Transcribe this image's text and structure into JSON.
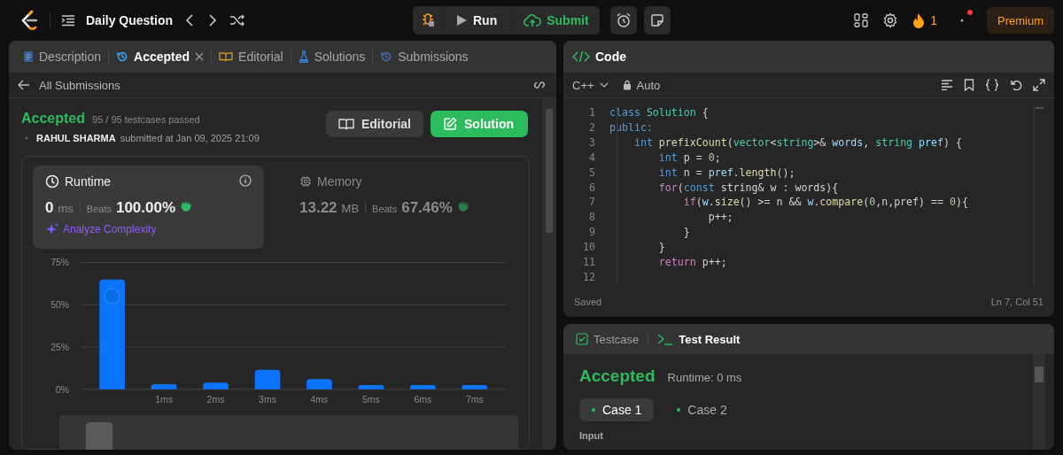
{
  "topbar": {
    "title": "Daily Question",
    "run": "Run",
    "submit": "Submit",
    "streak": "1",
    "premium": "Premium"
  },
  "left_tabs": [
    {
      "label": "Description",
      "kind": "doc",
      "selected": false,
      "closable": false
    },
    {
      "label": "Accepted",
      "kind": "clock",
      "selected": true,
      "closable": true
    },
    {
      "label": "Editorial",
      "kind": "book",
      "selected": false,
      "closable": false
    },
    {
      "label": "Solutions",
      "kind": "flask",
      "selected": false,
      "closable": false
    },
    {
      "label": "Submissions",
      "kind": "history",
      "selected": false,
      "closable": false
    }
  ],
  "back_link": "All Submissions",
  "result": {
    "status": "Accepted",
    "testcases": "95 / 95 testcases passed",
    "user": "RAHUL SHARMA",
    "submitted": "submitted at Jan 09, 2025 21:09",
    "buttons": [
      {
        "label": "Editorial",
        "kind": "secondary"
      },
      {
        "label": "Solution",
        "kind": "primary"
      }
    ]
  },
  "stats": [
    {
      "title": "Runtime",
      "kind": "time",
      "value": "0",
      "unit": "ms",
      "beats_label": "Beats",
      "beats": "100.00%",
      "selected": true,
      "link": "Analyze Complexity"
    },
    {
      "title": "Memory",
      "kind": "memory",
      "value": "13.22",
      "unit": "MB",
      "beats_label": "Beats",
      "beats": "67.46%",
      "selected": false
    }
  ],
  "chart_data": {
    "type": "bar",
    "x": [
      0,
      1,
      2,
      3,
      4,
      5,
      6,
      7
    ],
    "values": [
      65,
      3,
      4,
      11.5,
      6,
      2.5,
      2.5,
      2.5
    ],
    "xlim": [
      -0.6,
      7.6
    ],
    "ylim": [
      0,
      75
    ],
    "yticks": [
      {
        "value": 0,
        "label": "0%"
      },
      {
        "value": 25,
        "label": "25%"
      },
      {
        "value": 50,
        "label": "50%"
      },
      {
        "value": 75,
        "label": "75%"
      }
    ],
    "xticks": [
      {
        "value": 1,
        "label": "1ms"
      },
      {
        "value": 2,
        "label": "2ms"
      },
      {
        "value": 3,
        "label": "3ms"
      },
      {
        "value": 4,
        "label": "4ms"
      },
      {
        "value": 5,
        "label": "5ms"
      },
      {
        "value": 6,
        "label": "6ms"
      },
      {
        "value": 7,
        "label": "7ms"
      }
    ]
  },
  "code_panel": {
    "title": "Code",
    "language": "C++",
    "mode": "Auto",
    "status": "Saved",
    "cursor": "Ln 7, Col 51",
    "lines": [
      {
        "number": "1",
        "tokens": [
          {
            "t": "class",
            "kind": "kw"
          },
          {
            "t": " Solution",
            "kind": "type"
          },
          {
            "t": " {",
            "kind": "plain"
          }
        ]
      },
      {
        "number": "2",
        "tokens": [
          {
            "t": "public:",
            "kind": "kw"
          }
        ]
      },
      {
        "number": "3",
        "tokens": [
          {
            "t": "    int",
            "kind": "kw"
          },
          {
            "t": " prefixCount",
            "kind": "fn"
          },
          {
            "t": "(",
            "kind": "plain"
          },
          {
            "t": "vector",
            "kind": "type"
          },
          {
            "t": "<",
            "kind": "plain"
          },
          {
            "t": "string",
            "kind": "type"
          },
          {
            "t": ">& ",
            "kind": "plain"
          },
          {
            "t": "words",
            "kind": "var"
          },
          {
            "t": ", ",
            "kind": "plain"
          },
          {
            "t": "string",
            "kind": "type"
          },
          {
            "t": " pref",
            "kind": "var"
          },
          {
            "t": ") {",
            "kind": "plain"
          }
        ]
      },
      {
        "number": "4",
        "tokens": [
          {
            "t": "        int",
            "kind": "kw"
          },
          {
            "t": " p = ",
            "kind": "plain"
          },
          {
            "t": "0",
            "kind": "num"
          },
          {
            "t": ";",
            "kind": "plain"
          }
        ]
      },
      {
        "number": "5",
        "tokens": [
          {
            "t": "        int",
            "kind": "kw"
          },
          {
            "t": " n = ",
            "kind": "plain"
          },
          {
            "t": "pref",
            "kind": "var"
          },
          {
            "t": ".",
            "kind": "plain"
          },
          {
            "t": "length",
            "kind": "fn"
          },
          {
            "t": "();",
            "kind": "plain"
          }
        ]
      },
      {
        "number": "6",
        "tokens": [
          {
            "t": "        for",
            "kind": "ctrl"
          },
          {
            "t": "(",
            "kind": "plain"
          },
          {
            "t": "const",
            "kind": "kw"
          },
          {
            "t": " string& w : words){",
            "kind": "plain"
          }
        ]
      },
      {
        "number": "7",
        "tokens": [
          {
            "t": "            if",
            "kind": "ctrl"
          },
          {
            "t": "(",
            "kind": "plain"
          },
          {
            "t": "w",
            "kind": "var"
          },
          {
            "t": ".",
            "kind": "plain"
          },
          {
            "t": "size",
            "kind": "fn"
          },
          {
            "t": "() >= n && ",
            "kind": "plain"
          },
          {
            "t": "w",
            "kind": "var"
          },
          {
            "t": ".",
            "kind": "plain"
          },
          {
            "t": "compare",
            "kind": "fn"
          },
          {
            "t": "(",
            "kind": "plain"
          },
          {
            "t": "0",
            "kind": "num"
          },
          {
            "t": ",n,pref) == ",
            "kind": "plain"
          },
          {
            "t": "0",
            "kind": "num"
          },
          {
            "t": "){",
            "kind": "plain"
          }
        ]
      },
      {
        "number": "8",
        "tokens": [
          {
            "t": "                p++;",
            "kind": "plain"
          }
        ]
      },
      {
        "number": "9",
        "tokens": [
          {
            "t": "            }",
            "kind": "plain"
          }
        ]
      },
      {
        "number": "10",
        "tokens": [
          {
            "t": "        }",
            "kind": "plain"
          }
        ]
      },
      {
        "number": "11",
        "tokens": [
          {
            "t": "        return",
            "kind": "ctrl"
          },
          {
            "t": " p++;",
            "kind": "plain"
          }
        ]
      },
      {
        "number": "12"
      }
    ]
  },
  "test_panel": {
    "tabs": [
      {
        "label": "Testcase",
        "kind": "check",
        "selected": false
      },
      {
        "label": "Test Result",
        "kind": "terminal",
        "selected": true
      }
    ],
    "status": "Accepted",
    "runtime": "Runtime: 0 ms",
    "cases": [
      {
        "label": "Case 1",
        "selected": true
      },
      {
        "label": "Case 2",
        "selected": false
      }
    ],
    "input_label": "Input"
  }
}
